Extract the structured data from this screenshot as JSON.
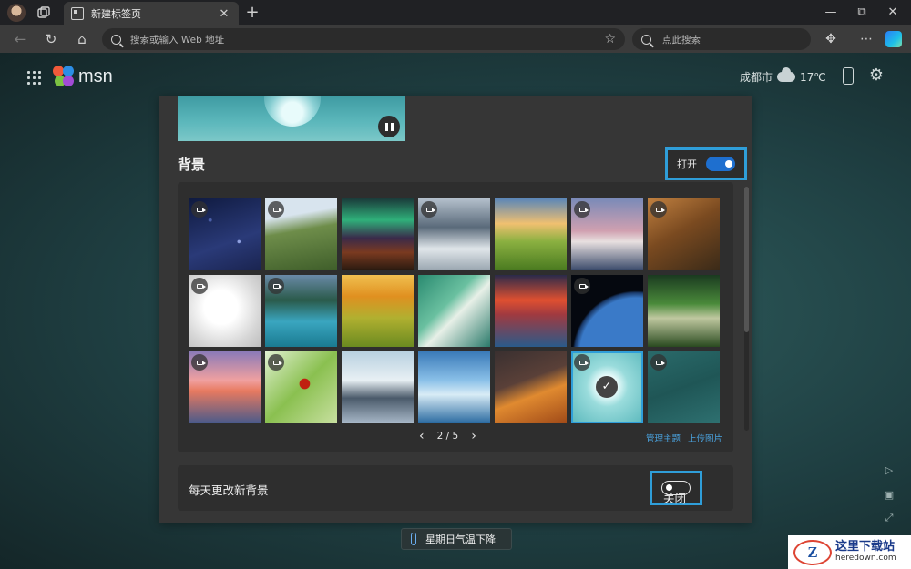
{
  "browser": {
    "tab_title": "新建标签页",
    "tab_close": "✕",
    "new_tab": "+",
    "address_placeholder": "搜索或输入 Web 地址",
    "search_placeholder": "点此搜索",
    "win_min": "—",
    "win_max": "⧉",
    "win_close": "✕",
    "more": "⋯"
  },
  "msn": {
    "logo_text": "msn",
    "city": "成都市",
    "temperature": "17℃"
  },
  "background_section": {
    "title": "背景",
    "toggle_label": "打开",
    "toggle_state": "on",
    "pager_text": "2 / 5",
    "prev": "‹",
    "next": "›",
    "manage_theme": "管理主题",
    "upload_image": "上传图片",
    "thumbnails": [
      {
        "name": "starry-sky",
        "video": true
      },
      {
        "name": "green-mountains",
        "video": true
      },
      {
        "name": "aurora-waterfall",
        "video": false
      },
      {
        "name": "misty-peaks",
        "video": true
      },
      {
        "name": "green-hills-sunrise",
        "video": false
      },
      {
        "name": "coastal-town-dusk",
        "video": true
      },
      {
        "name": "giraffes",
        "video": true
      },
      {
        "name": "white-sculpture",
        "video": true
      },
      {
        "name": "turquoise-lake",
        "video": true
      },
      {
        "name": "golden-fields",
        "video": false
      },
      {
        "name": "aerial-coast",
        "video": false
      },
      {
        "name": "red-sky-island",
        "video": false
      },
      {
        "name": "earth-from-space",
        "video": true
      },
      {
        "name": "forest-path",
        "video": false
      },
      {
        "name": "pier-sunset",
        "video": true
      },
      {
        "name": "ladybug-leaf",
        "video": true
      },
      {
        "name": "rocky-shore",
        "video": false
      },
      {
        "name": "glacier",
        "video": false
      },
      {
        "name": "desert-dunes",
        "video": false
      },
      {
        "name": "water-drop",
        "video": true,
        "selected": true
      },
      {
        "name": "teal-water",
        "video": true
      }
    ]
  },
  "daily_section": {
    "title": "每天更改新背景",
    "toggle_label": "关闭",
    "toggle_state": "off"
  },
  "weather_chip": "星期日气温下降",
  "watermark": {
    "logo": "Z",
    "cn": "这里下载站",
    "en": "heredown.com"
  },
  "colors": {
    "accent": "#2f9ed9",
    "toggle_on": "#1e6fcf",
    "link": "#4aa3df"
  }
}
